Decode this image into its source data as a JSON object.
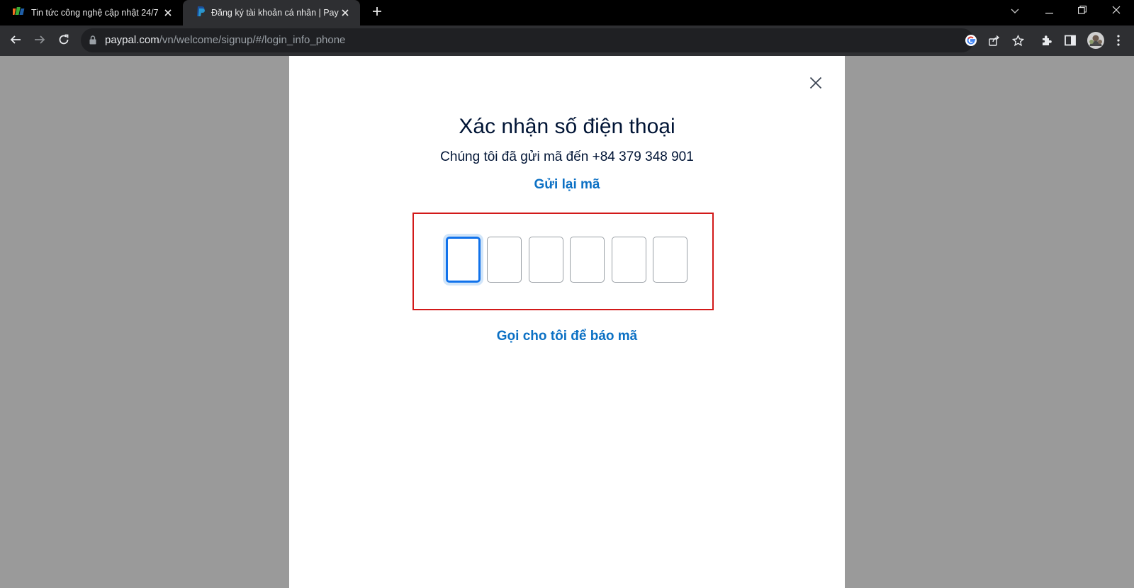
{
  "tabs": [
    {
      "title": "Tin tức công nghệ cập nhật 24/7",
      "icon": "fpt-logo-icon",
      "active": false
    },
    {
      "title": "Đăng ký tài khoản cá nhân | PayPal",
      "icon": "paypal-logo-icon",
      "active": true
    }
  ],
  "address_bar": {
    "host": "paypal.com",
    "path": "/vn/welcome/signup/#/login_info_phone"
  },
  "dialog": {
    "title": "Xác nhận số điện thoại",
    "subtitle": "Chúng tôi đã gửi mã đến +84 379 348 901",
    "resend_link": "Gửi lại mã",
    "call_link": "Gọi cho tôi để báo mã",
    "otp_digits": [
      "",
      "",
      "",
      "",
      "",
      ""
    ]
  },
  "colors": {
    "accent": "#0b70c4",
    "heading": "#001435",
    "highlight": "#d21919",
    "focus": "#1072eb"
  }
}
